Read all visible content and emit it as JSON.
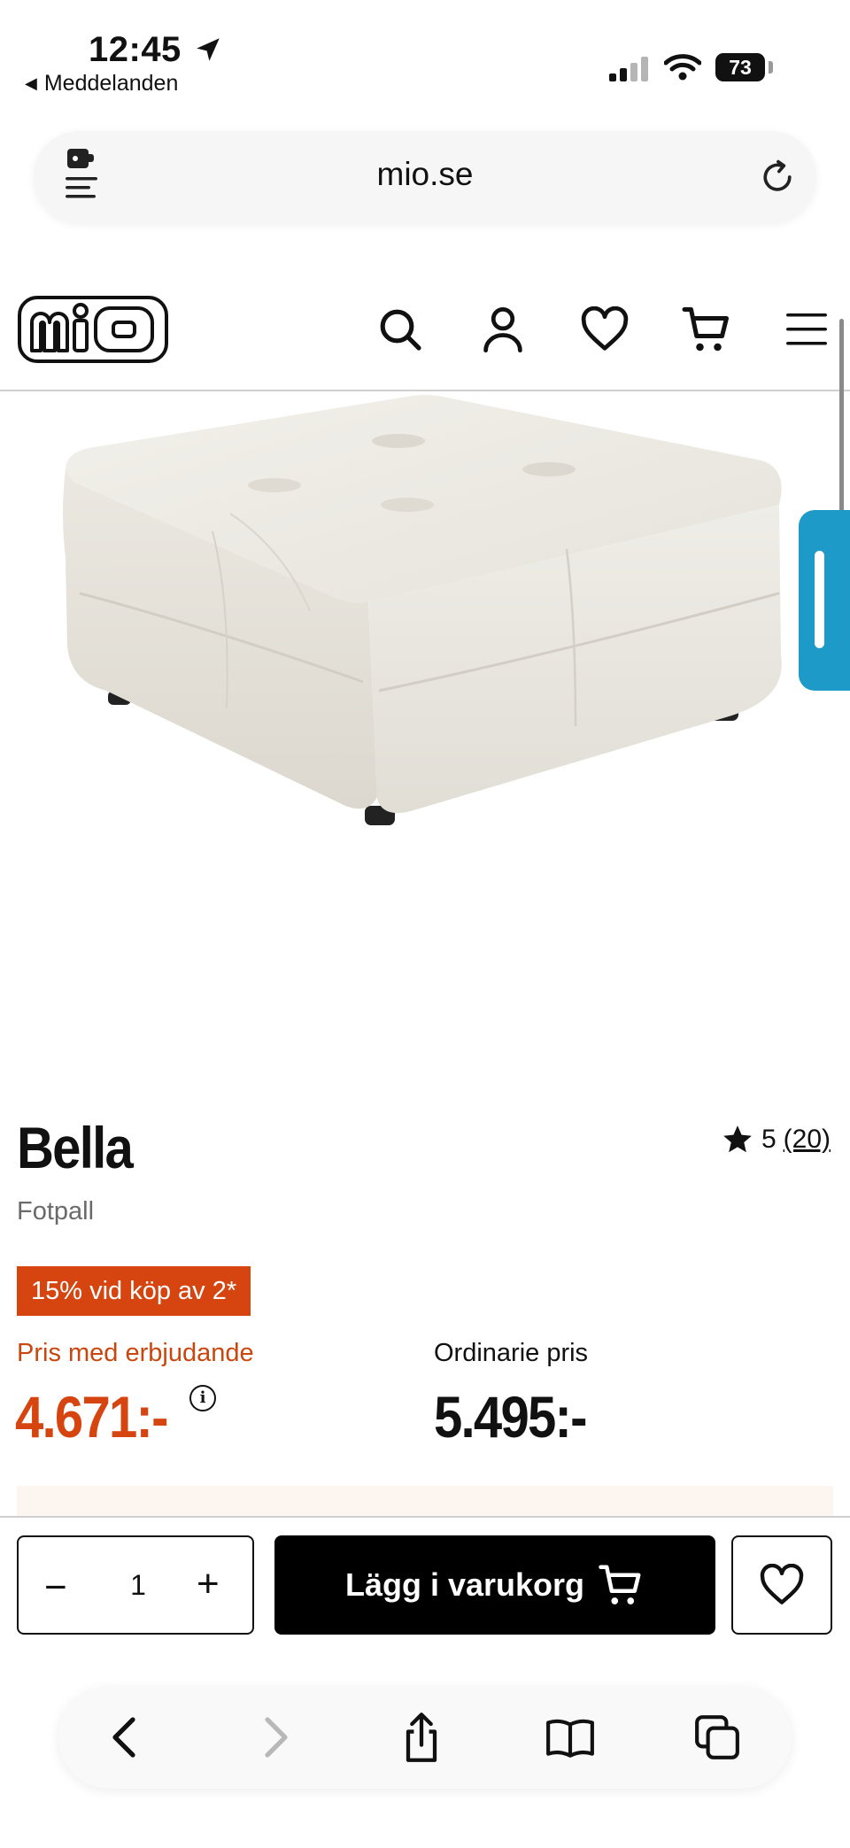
{
  "status_bar": {
    "time": "12:45",
    "back_app": "Meddelanden",
    "battery": "73"
  },
  "browser": {
    "url": "mio.se"
  },
  "header": {
    "logo_text": "mio"
  },
  "product": {
    "name": "Bella",
    "subtitle": "Fotpall",
    "rating": "5",
    "review_count": "(20)",
    "promo_badge": "15% vid köp av 2*",
    "offer_label": "Pris med erbjudande",
    "offer_price": "4.671:-",
    "regular_label": "Ordinarie pris",
    "regular_price": "5.495:-"
  },
  "cart": {
    "quantity": "1",
    "minus": "−",
    "plus": "+",
    "add_label": "Lägg i varukorg"
  },
  "colors": {
    "accent_orange": "#d6450f",
    "side_tab": "#1d9ac7"
  }
}
